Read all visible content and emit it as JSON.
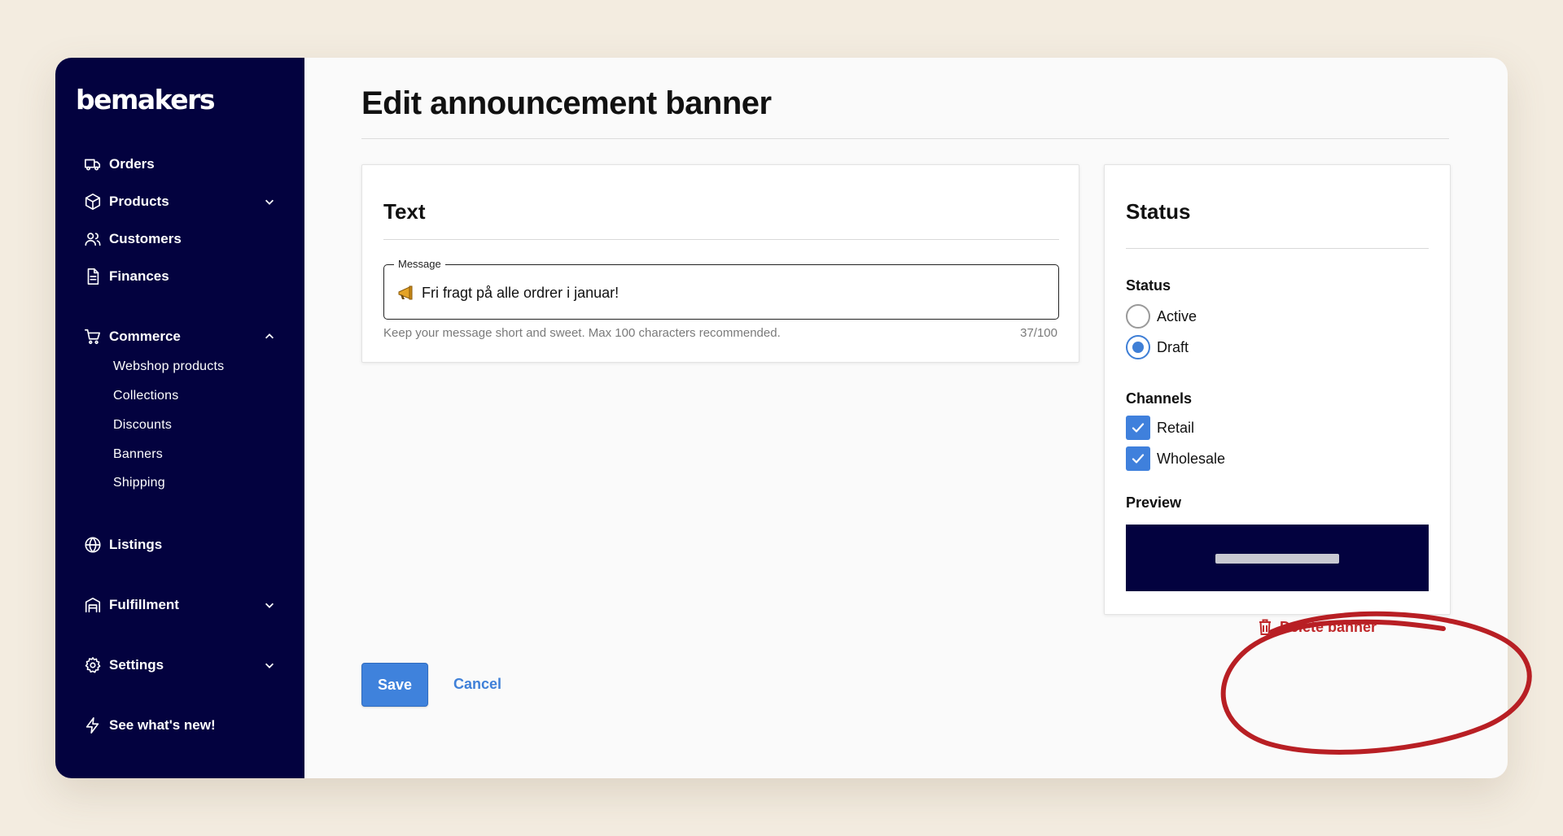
{
  "app": {
    "logo": "bemakers"
  },
  "sidebar": {
    "items": [
      {
        "label": "Orders",
        "icon": "truck-icon"
      },
      {
        "label": "Products",
        "icon": "box-icon",
        "chevron": "down"
      },
      {
        "label": "Customers",
        "icon": "users-icon"
      },
      {
        "label": "Finances",
        "icon": "document-icon"
      },
      {
        "label": "Commerce",
        "icon": "cart-icon",
        "chevron": "up"
      },
      {
        "label": "Listings",
        "icon": "globe-icon"
      },
      {
        "label": "Fulfillment",
        "icon": "warehouse-icon",
        "chevron": "down"
      },
      {
        "label": "Settings",
        "icon": "gear-icon",
        "chevron": "down"
      },
      {
        "label": "See what's new!",
        "icon": "lightning-icon"
      }
    ],
    "commerce_sub": [
      "Webshop products",
      "Collections",
      "Discounts",
      "Banners",
      "Shipping"
    ]
  },
  "page": {
    "title": "Edit announcement banner"
  },
  "text_card": {
    "heading": "Text",
    "message_label": "Message",
    "message_value": "Fri fragt på alle ordrer i januar!",
    "message_icon": "megaphone-icon",
    "helper": "Keep your message short and sweet. Max 100 characters recommended.",
    "counter": "37/100"
  },
  "status_card": {
    "heading": "Status",
    "status_label": "Status",
    "status_options": [
      {
        "label": "Active",
        "selected": false
      },
      {
        "label": "Draft",
        "selected": true
      }
    ],
    "channels_label": "Channels",
    "channels": [
      {
        "label": "Retail",
        "checked": true
      },
      {
        "label": "Wholesale",
        "checked": true
      }
    ],
    "preview_label": "Preview"
  },
  "actions": {
    "save": "Save",
    "cancel": "Cancel",
    "delete": "Delete banner"
  },
  "colors": {
    "sidebar_bg": "#03023f",
    "accent": "#3f82dc",
    "danger": "#c0282a",
    "page_bg": "#f3ece0"
  }
}
